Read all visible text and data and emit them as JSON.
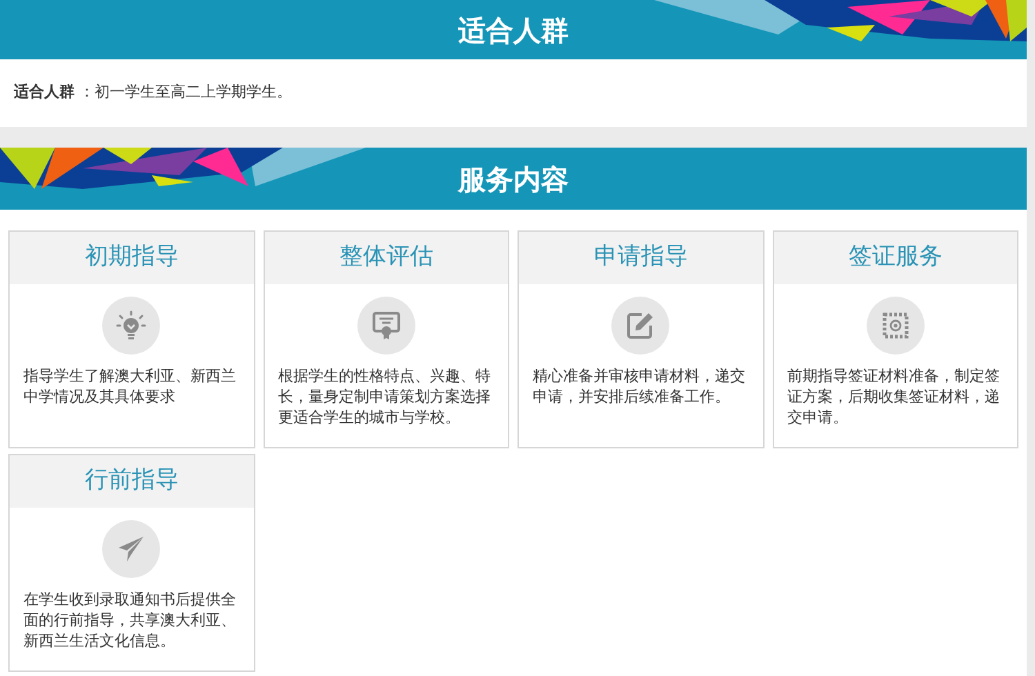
{
  "audience": {
    "title": "适合人群",
    "text": "**适合人群** ：初一学生至高二上学期学生。"
  },
  "services": {
    "title": "服务内容",
    "cards": [
      {
        "kind": "initial",
        "title": "初期指导",
        "text": "指导学生了解澳大利亚、新西兰中学情况及其具体要求"
      },
      {
        "kind": "assessment",
        "title": "整体评估",
        "text": "根据学生的性格特点、兴趣、特长，量身定制申请策划方案选择更适合学生的城市与学校。"
      },
      {
        "kind": "application",
        "title": "申请指导",
        "text": "精心准备并审核申请材料，递交申请，并安排后续准备工作。"
      },
      {
        "kind": "visa",
        "title": "签证服务",
        "text": "前期指导签证材料准备，制定签证方案，后期收集签证材料，递交申请。"
      },
      {
        "kind": "departure",
        "title": "行前指导",
        "text": "在学生收到录取通知书后提供全面的行前指导，共享澳大利亚、新西兰生活文化信息。"
      }
    ]
  }
}
